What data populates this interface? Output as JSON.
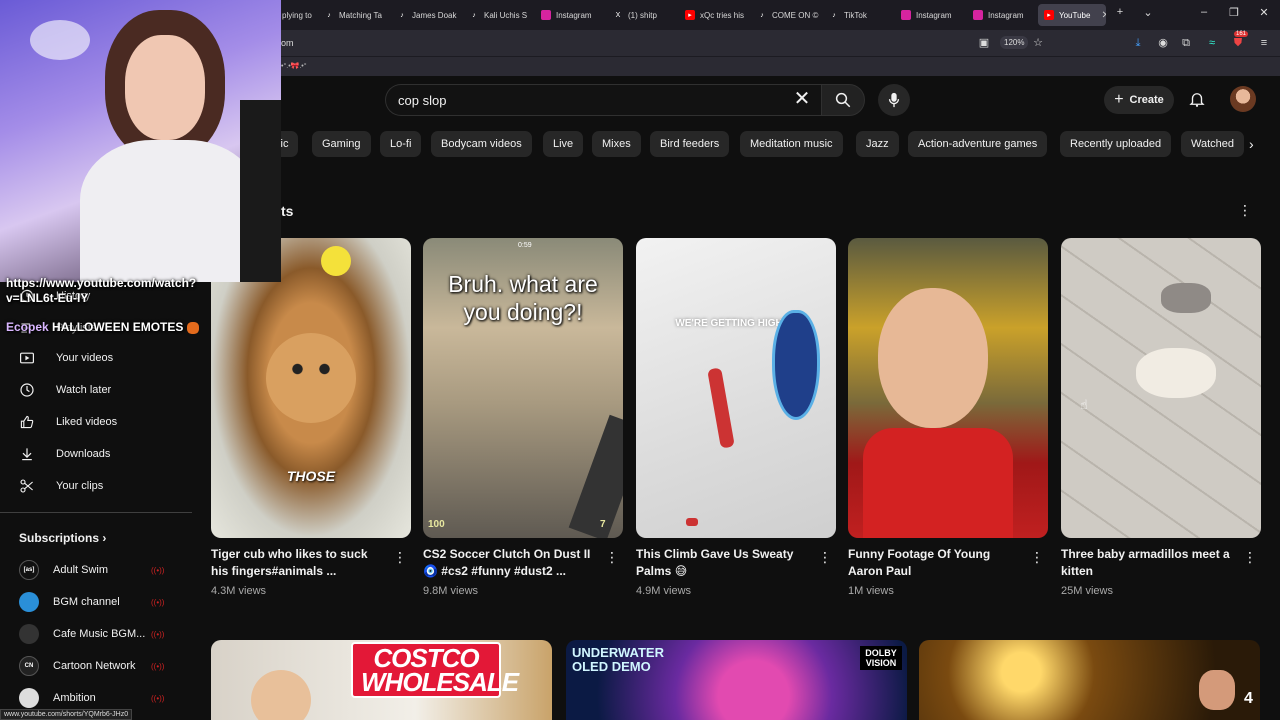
{
  "browser": {
    "tabs": [
      {
        "label": "plying to",
        "icon": ""
      },
      {
        "label": "Matching Ta",
        "icon": "tiktok"
      },
      {
        "label": "James Doak",
        "icon": "tiktok"
      },
      {
        "label": "Kali Uchis S",
        "icon": "tiktok"
      },
      {
        "label": "Instagram",
        "icon": "instagram"
      },
      {
        "label": "(1) shitp",
        "icon": "x"
      },
      {
        "label": "xQc tries his",
        "icon": "youtube"
      },
      {
        "label": "COME ON ©",
        "icon": "tiktok"
      },
      {
        "label": "TikTok",
        "icon": "tiktok"
      },
      {
        "label": "Instagram",
        "icon": "instagram"
      },
      {
        "label": "Instagram",
        "icon": "instagram"
      },
      {
        "label": "YouTube",
        "icon": "youtube"
      }
    ],
    "url_fragment": "om",
    "zoom": "120%",
    "notification_count": "161",
    "bookmark_text": "•°.•🎀.•°"
  },
  "search": {
    "query": "cop slop"
  },
  "header": {
    "create_label": "Create"
  },
  "chips": [
    "sic",
    "Gaming",
    "Lo-fi",
    "Bodycam videos",
    "Live",
    "Mixes",
    "Bird feeders",
    "Meditation music",
    "Jazz",
    "Action-adventure games",
    "Recently uploaded",
    "Watched"
  ],
  "shorts": {
    "heading": "ts",
    "items": [
      {
        "title": "Tiger cub who likes to suck his fingers#animals ...",
        "views": "4.3M views",
        "caption": "THOSE"
      },
      {
        "title": "CS2 Soccer Clutch On Dust II 🧿 #cs2 #funny #dust2 ...",
        "views": "9.8M views",
        "caption": "Bruh. what are you doing?!",
        "hud_left": "100",
        "hud_right": "7",
        "hud_time": "0:59"
      },
      {
        "title": "This Climb Gave Us Sweaty Palms 😅",
        "views": "4.9M views",
        "caption": "WE'RE GETTING HIGHER"
      },
      {
        "title": "Funny Footage Of Young Aaron Paul",
        "views": "1M views",
        "caption": ""
      },
      {
        "title": "Three baby armadillos meet a kitten",
        "views": "25M views",
        "caption": ""
      }
    ]
  },
  "sidebar": {
    "items": [
      {
        "label": "History",
        "icon": "history-icon"
      },
      {
        "label": "Playlists",
        "icon": "playlist-icon"
      },
      {
        "label": "Your videos",
        "icon": "your-videos-icon"
      },
      {
        "label": "Watch later",
        "icon": "clock-icon"
      },
      {
        "label": "Liked videos",
        "icon": "thumbs-up-icon"
      },
      {
        "label": "Downloads",
        "icon": "download-icon"
      },
      {
        "label": "Your clips",
        "icon": "scissors-icon"
      }
    ],
    "subscriptions_heading": "Subscriptions",
    "subscriptions": [
      {
        "label": "Adult Swim",
        "avatar": "[as]",
        "color": "#111111"
      },
      {
        "label": "BGM channel",
        "avatar": "",
        "color": "#2a8fd8"
      },
      {
        "label": "Cafe Music BGM...",
        "avatar": "",
        "color": "#333333"
      },
      {
        "label": "Cartoon Network",
        "avatar": "CN",
        "color": "#222222"
      },
      {
        "label": "Ambition",
        "avatar": "",
        "color": "#dddddd"
      }
    ]
  },
  "bottom_videos": [
    {
      "title": "COSTCO WHOLESALE",
      "badge": ""
    },
    {
      "title": "UNDERWATER OLED DEMO",
      "badge": "DOLBY VISION"
    },
    {
      "title": "",
      "badge": "4"
    }
  ],
  "overlay": {
    "url_line1": "https://www.youtube.com/watch?",
    "url_line2": "v=LNL6t-Eu-IY",
    "emotes_prefix": "Ecopek",
    "emotes": "HALLOWEEN EMOTES"
  },
  "status_url": "www.youtube.com/shorts/YQMrb6-JHz0",
  "colors": {
    "background": "#0f0f0f",
    "chip": "#272727",
    "youtube_red": "#ff0000",
    "muted_text": "#aaaaaa"
  }
}
